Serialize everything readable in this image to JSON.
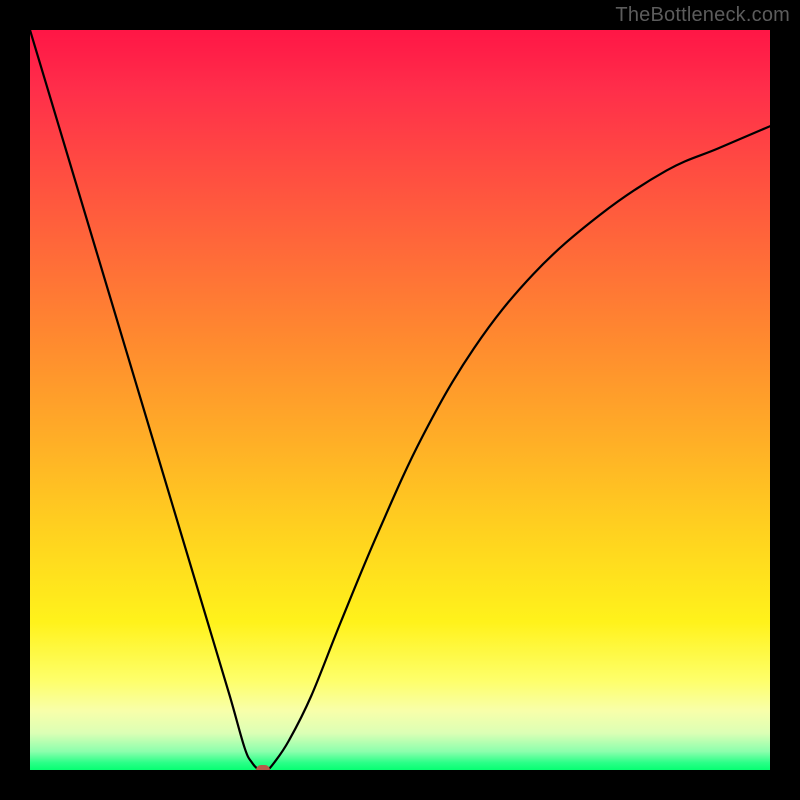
{
  "watermark": "TheBottleneck.com",
  "colors": {
    "background": "#000000",
    "watermark_text": "#5c5c5c",
    "curve_stroke": "#000000",
    "marker_fill": "#b75a4a",
    "gradient_stops": [
      {
        "offset": 0,
        "color": "#ff1646"
      },
      {
        "offset": 0.08,
        "color": "#ff2e4a"
      },
      {
        "offset": 0.18,
        "color": "#ff4a42"
      },
      {
        "offset": 0.3,
        "color": "#ff6a39"
      },
      {
        "offset": 0.42,
        "color": "#ff8a2f"
      },
      {
        "offset": 0.55,
        "color": "#ffad27"
      },
      {
        "offset": 0.68,
        "color": "#ffd21f"
      },
      {
        "offset": 0.8,
        "color": "#fff21b"
      },
      {
        "offset": 0.88,
        "color": "#feff6b"
      },
      {
        "offset": 0.92,
        "color": "#f8ffaa"
      },
      {
        "offset": 0.95,
        "color": "#dcffb5"
      },
      {
        "offset": 0.975,
        "color": "#8cffad"
      },
      {
        "offset": 0.99,
        "color": "#07ff72"
      },
      {
        "offset": 1.0,
        "color": "#07ff72"
      }
    ]
  },
  "chart_data": {
    "type": "line",
    "title": "",
    "xlabel": "",
    "ylabel": "",
    "xlim": [
      0,
      100
    ],
    "ylim": [
      0,
      100
    ],
    "series": [
      {
        "name": "bottleneck-curve",
        "x": [
          0,
          3,
          6,
          9,
          12,
          15,
          18,
          21,
          24,
          27,
          29,
          30,
          31,
          32,
          33,
          35,
          38,
          42,
          47,
          53,
          60,
          68,
          77,
          86,
          93,
          100
        ],
        "y": [
          100,
          90,
          80,
          70,
          60,
          50,
          40,
          30,
          20,
          10,
          3,
          1,
          0,
          0,
          1,
          4,
          10,
          20,
          32,
          45,
          57,
          67,
          75,
          81,
          84,
          87
        ]
      }
    ],
    "marker": {
      "x": 31.5,
      "y": 0
    },
    "background_scale": {
      "orientation": "vertical",
      "meaning": "bottleneck-severity",
      "top_value": 100,
      "bottom_value": 0
    }
  }
}
